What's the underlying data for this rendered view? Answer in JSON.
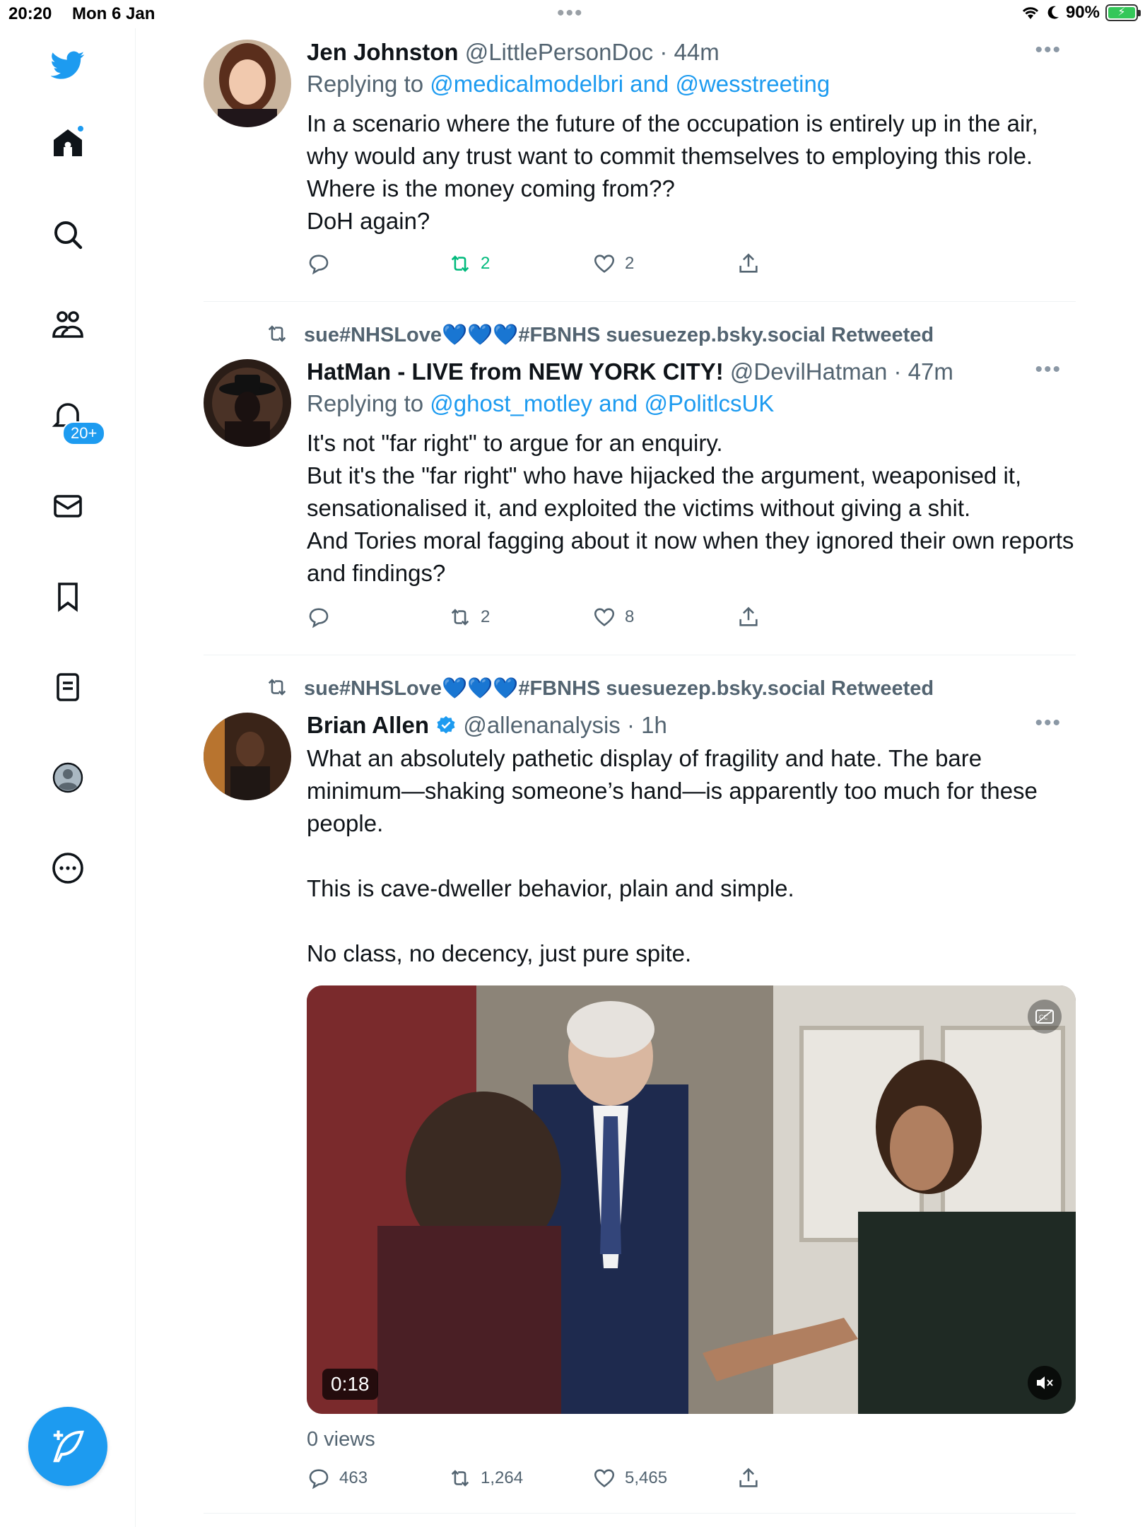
{
  "status_bar": {
    "time": "20:20",
    "date": "Mon 6 Jan",
    "battery": "90%"
  },
  "sidebar": {
    "notifications_badge": "20+",
    "items": [
      "home-icon",
      "search-icon",
      "communities-icon",
      "notifications-icon",
      "messages-icon",
      "bookmarks-icon",
      "lists-icon",
      "profile-icon",
      "more-icon"
    ]
  },
  "colors": {
    "accent": "#1d9bf0",
    "retweet_active": "#00ba7c",
    "muted": "#536471"
  },
  "tweets": [
    {
      "name": "Jen Johnston",
      "handle": "@LittlePersonDoc",
      "time": "44m",
      "reply_label": "Replying to",
      "reply_to": "@medicalmodelbri and @wesstreeting",
      "text": [
        "In a scenario where the future of the occupation is entirely up in the air, why would any trust want to commit themselves to employing this role.",
        "Where is the money coming from??",
        "DoH again?"
      ],
      "replies": "",
      "retweets": "2",
      "likes": "2"
    },
    {
      "retweeted_by": "sue#NHSLove",
      "retweeted_suffix": "#FBNHS suesuezep.bsky.social Retweeted",
      "name": "HatMan - LIVE from NEW YORK CITY!",
      "handle": "@DevilHatman",
      "time": "47m",
      "reply_label": "Replying to",
      "reply_to": "@ghost_motley and @PolitlcsUK",
      "text": [
        "It's not \"far right\" to argue for an enquiry.",
        "But it's the \"far right\" who have hijacked the argument, weaponised it, sensationalised it, and exploited the victims without giving a shit.",
        "And Tories moral fagging about it now when they ignored their own reports and findings?"
      ],
      "replies": "",
      "retweets": "2",
      "likes": "8"
    },
    {
      "retweeted_by": "sue#NHSLove",
      "retweeted_suffix": "#FBNHS suesuezep.bsky.social Retweeted",
      "name": "Brian Allen",
      "handle": "@allenanalysis",
      "time": "1h",
      "text": [
        "What an absolutely pathetic display of fragility and hate. The bare minimum—shaking someone’s hand—is apparently too much for these people.",
        "This is cave-dweller behavior, plain and simple.",
        "No class, no decency, just pure spite."
      ],
      "video_duration": "0:18",
      "views": "0 views",
      "replies": "463",
      "retweets": "1,264",
      "likes": "5,465"
    }
  ]
}
